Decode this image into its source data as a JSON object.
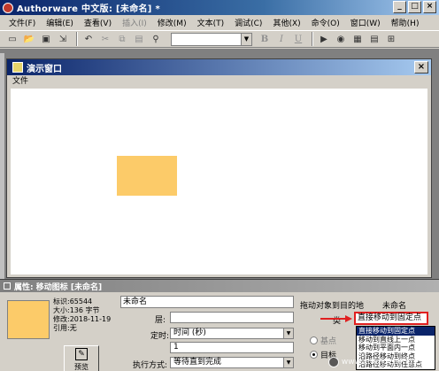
{
  "window": {
    "title": "Authorware 中文版: [未命名] *",
    "controls": [
      "_",
      "□",
      "×"
    ]
  },
  "menu": [
    {
      "label": "文件(F)",
      "enabled": true
    },
    {
      "label": "编辑(E)",
      "enabled": true
    },
    {
      "label": "查看(V)",
      "enabled": true
    },
    {
      "label": "插入(I)",
      "enabled": false
    },
    {
      "label": "修改(M)",
      "enabled": true
    },
    {
      "label": "文本(T)",
      "enabled": true
    },
    {
      "label": "调试(C)",
      "enabled": true
    },
    {
      "label": "其他(X)",
      "enabled": true
    },
    {
      "label": "命令(O)",
      "enabled": true
    },
    {
      "label": "窗口(W)",
      "enabled": true
    },
    {
      "label": "帮助(H)",
      "enabled": true
    }
  ],
  "toolbar": {
    "bold": "B",
    "italic": "I",
    "underline": "U"
  },
  "presentation_window": {
    "title": "演示窗口",
    "close": "×",
    "menu_file": "文件"
  },
  "properties": {
    "title": "属性: 移动图标 [未命名]",
    "info_lines": [
      "标识:65544",
      "大小:136 字节",
      "修改:2018-11-19",
      "引用:无"
    ],
    "open_label": "预览",
    "icon_name": "未命名",
    "layer_label": "层:",
    "layer_value": "",
    "timing_label": "定时:",
    "timing_value": "时间 (秒)",
    "timing_number": "1",
    "exec_label": "执行方式:",
    "exec_value": "等待直到完成",
    "type_label": "拖动对象到目的地",
    "type_value": "未命名",
    "motion_label": "类",
    "motion_selected": "直接移动到固定点",
    "motion_options": [
      "直接移动到固定点",
      "移动到直线上一点",
      "移动到平面内一点",
      "沿路径移动到终点",
      "沿路径移动到任意点"
    ],
    "radio_base": "基点",
    "radio_target": "目标"
  },
  "watermark": "www.xitongcheng.com",
  "colors": {
    "title_bar": "#0a246a",
    "object_fill": "#fccb69",
    "highlight": "#e02020",
    "face": "#d4d0c8"
  }
}
